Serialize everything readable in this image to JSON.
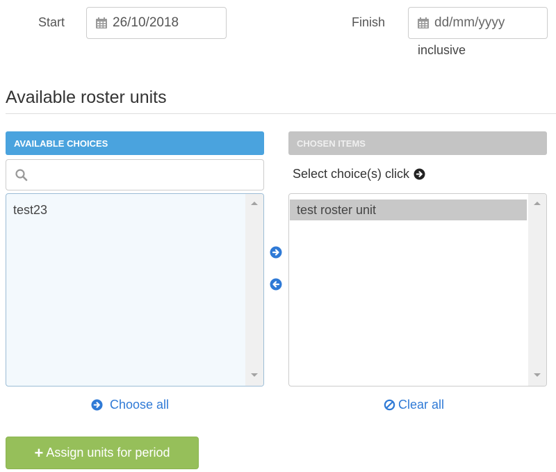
{
  "dates": {
    "start_label": "Start",
    "start_value": "26/10/2018",
    "finish_label": "Finish",
    "finish_placeholder": "dd/mm/yyyy",
    "finish_note": "inclusive",
    "calendar_icon": "calendar-icon"
  },
  "section": {
    "title": "Available roster units"
  },
  "available": {
    "header": "AVAILABLE CHOICES",
    "search_placeholder": "",
    "search_icon": "search-icon",
    "items": [
      "test23"
    ],
    "choose_all_label": "Choose all"
  },
  "chosen": {
    "header": "CHOSEN ITEMS",
    "hint": "Select choice(s) click",
    "items": [
      "test roster unit"
    ],
    "clear_all_label": "Clear all"
  },
  "actions": {
    "move_right_icon": "arrow-circle-right-icon",
    "move_left_icon": "arrow-circle-left-icon",
    "assign_label": "Assign units for period"
  },
  "colors": {
    "available_header": "#4aa3de",
    "chosen_header": "#c4c4c4",
    "link": "#2f7ad6",
    "assign_button": "#96bf5a"
  }
}
